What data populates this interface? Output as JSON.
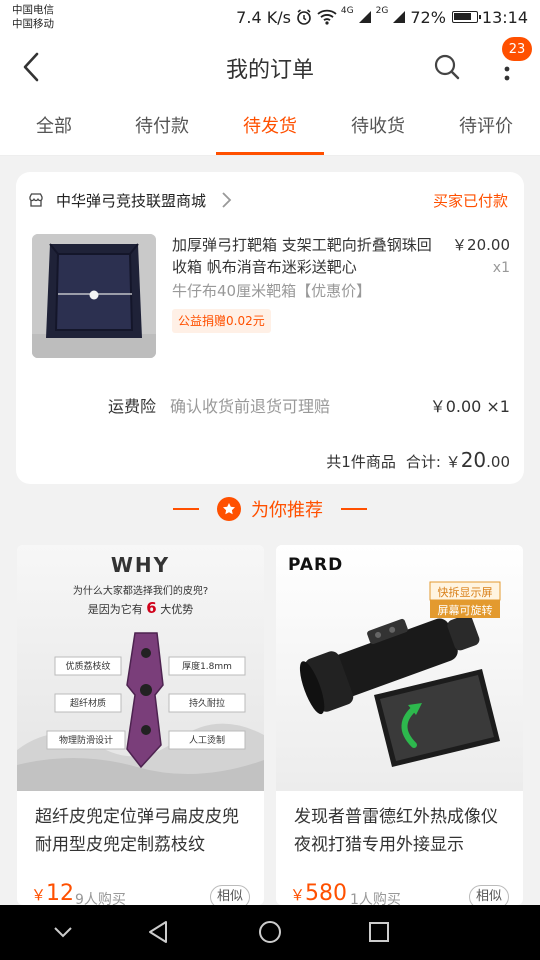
{
  "status": {
    "carrier1": "中国电信",
    "carrier2": "中国移动",
    "speed": "7.4 K/s",
    "battery": "72%",
    "time": "13:14",
    "net_labels": [
      "4G",
      "2G"
    ]
  },
  "header": {
    "title": "我的订单",
    "badge_count": "23"
  },
  "tabs": [
    {
      "label": "全部"
    },
    {
      "label": "待付款"
    },
    {
      "label": "待发货"
    },
    {
      "label": "待收货"
    },
    {
      "label": "待评价"
    }
  ],
  "order": {
    "shop_name": "中华弹弓竞技联盟商城",
    "status": "买家已付款",
    "product_title": "加厚弹弓打靶箱 支架工靶向折叠钢珠回收箱 帆布消音布迷彩送靶心",
    "sku": "牛仔布40厘米靶箱【优惠价】",
    "charity_tag": "公益捐赠0.02元",
    "price": "￥20.00",
    "qty": "x1",
    "insurance_label": "运费险",
    "insurance_desc": "确认收货前退货可理赔",
    "insurance_price": "￥0.00 ×1",
    "total_count": "共1件商品",
    "total_label": "合计:",
    "total_symbol": "￥",
    "total_int": "20",
    "total_dec": ".00"
  },
  "recommend": {
    "title": "为你推荐",
    "items": [
      {
        "title": "超纤皮兜定位弹弓扁皮皮兜耐用型皮兜定制荔枝纹",
        "price_symbol": "￥",
        "price": "12",
        "sold": "9人购买",
        "similar": "相似",
        "img": {
          "why": "WHY",
          "q": "为什么大家都选择我们的皮兜?",
          "a_pre": "是因为它有",
          "a_num": "6",
          "a_post": "大优势",
          "tags": [
            "优质荔枝纹",
            "厚度1.8mm",
            "超纤材质",
            "持久耐拉",
            "物理防滑设计",
            "人工烫制"
          ]
        }
      },
      {
        "title": "发现者普雷德红外热成像仪夜视打猎专用外接显示",
        "price_symbol": "￥",
        "price": "580",
        "sold": "1人购买",
        "similar": "相似",
        "img": {
          "brand": "PARD",
          "badge1": "快拆显示屏",
          "badge2": "屏幕可旋转"
        }
      }
    ]
  },
  "colors": {
    "accent": "#ff5000",
    "background": "#f2f2f2"
  },
  "icons": [
    "back-arrow-icon",
    "search-icon",
    "more-dots-icon",
    "shop-icon",
    "chevron-right-icon",
    "star-icon",
    "nav-back-icon",
    "nav-home-icon",
    "nav-recents-icon",
    "nav-collapse-icon"
  ]
}
